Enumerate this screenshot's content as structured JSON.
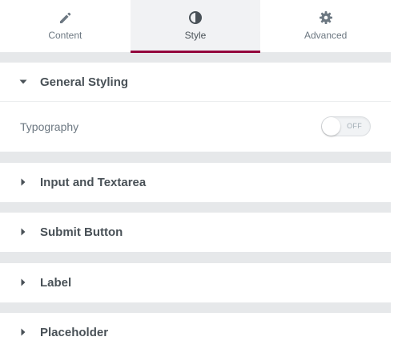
{
  "tabs": [
    {
      "label": "Content",
      "icon": "pencil-icon",
      "active": false
    },
    {
      "label": "Style",
      "icon": "contrast-icon",
      "active": true
    },
    {
      "label": "Advanced",
      "icon": "gear-icon",
      "active": false
    }
  ],
  "sections": [
    {
      "title": "General Styling",
      "expanded": true,
      "controls": [
        {
          "label": "Typography",
          "toggle": {
            "state": "OFF"
          }
        }
      ]
    },
    {
      "title": "Input and Textarea",
      "expanded": false
    },
    {
      "title": "Submit Button",
      "expanded": false
    },
    {
      "title": "Label",
      "expanded": false
    },
    {
      "title": "Placeholder",
      "expanded": false
    }
  ],
  "colors": {
    "accent": "#93003c",
    "text": "#495157",
    "muted": "#6d7882",
    "separator": "#e6e8ea"
  }
}
